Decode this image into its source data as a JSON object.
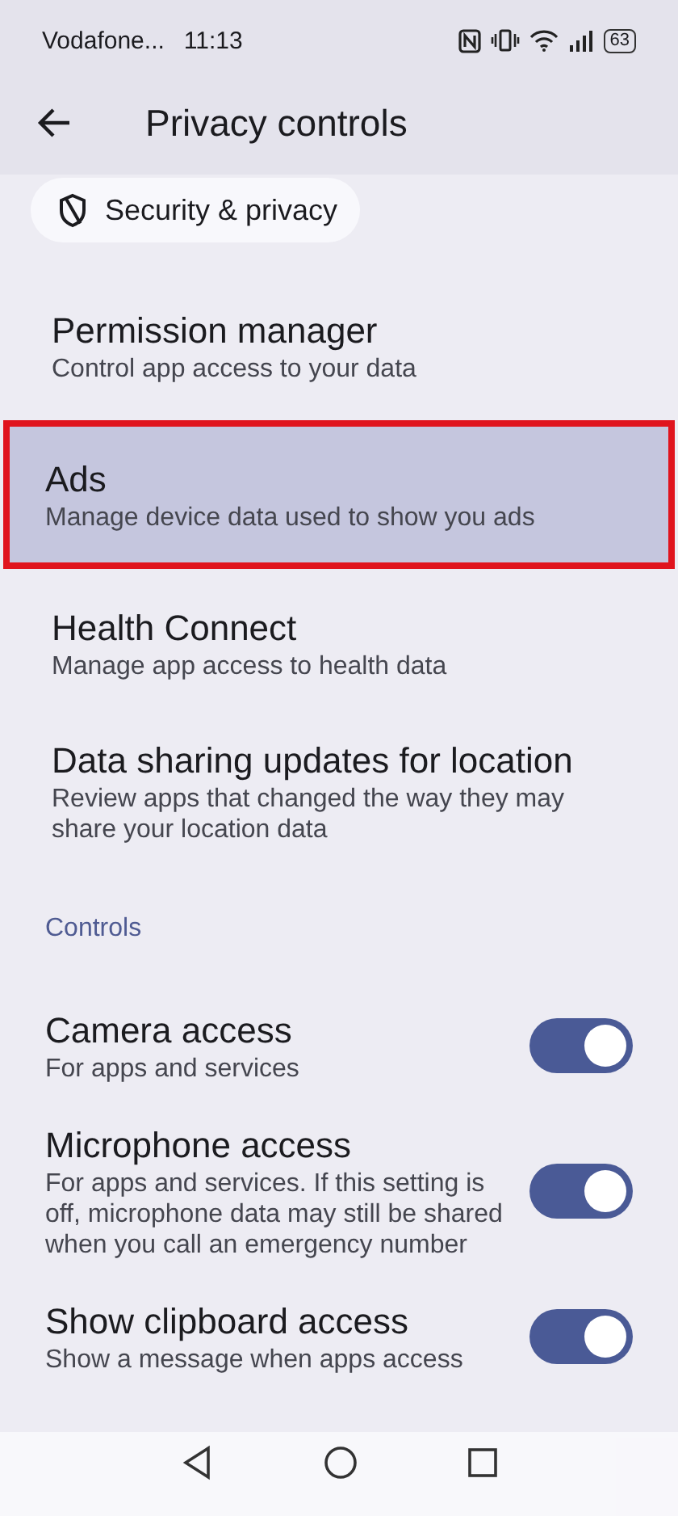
{
  "status_bar": {
    "carrier": "Vodafone...",
    "time": "11:13",
    "battery": "63"
  },
  "header": {
    "title": "Privacy controls"
  },
  "breadcrumb": {
    "label": "Security & privacy"
  },
  "items": [
    {
      "kind": "link",
      "title": "Permission manager",
      "subtitle": "Control app access to your data",
      "selected": false
    },
    {
      "kind": "link",
      "title": "Ads",
      "subtitle": "Manage device data used to show you ads",
      "selected": true
    },
    {
      "kind": "link",
      "title": "Health Connect",
      "subtitle": "Manage app access to health data",
      "selected": false
    },
    {
      "kind": "link",
      "title": "Data sharing updates for location",
      "subtitle": "Review apps that changed the way they may share your location data",
      "selected": false
    },
    {
      "kind": "section",
      "title": "Controls"
    },
    {
      "kind": "toggle",
      "title": "Camera access",
      "subtitle": "For apps and services",
      "on": true
    },
    {
      "kind": "toggle",
      "title": "Microphone access",
      "subtitle": "For apps and services. If this setting is off, microphone data may still be shared when you call an emergency number",
      "on": true
    },
    {
      "kind": "toggle",
      "title": "Show clipboard access",
      "subtitle": "Show a message when apps access",
      "on": true
    }
  ]
}
